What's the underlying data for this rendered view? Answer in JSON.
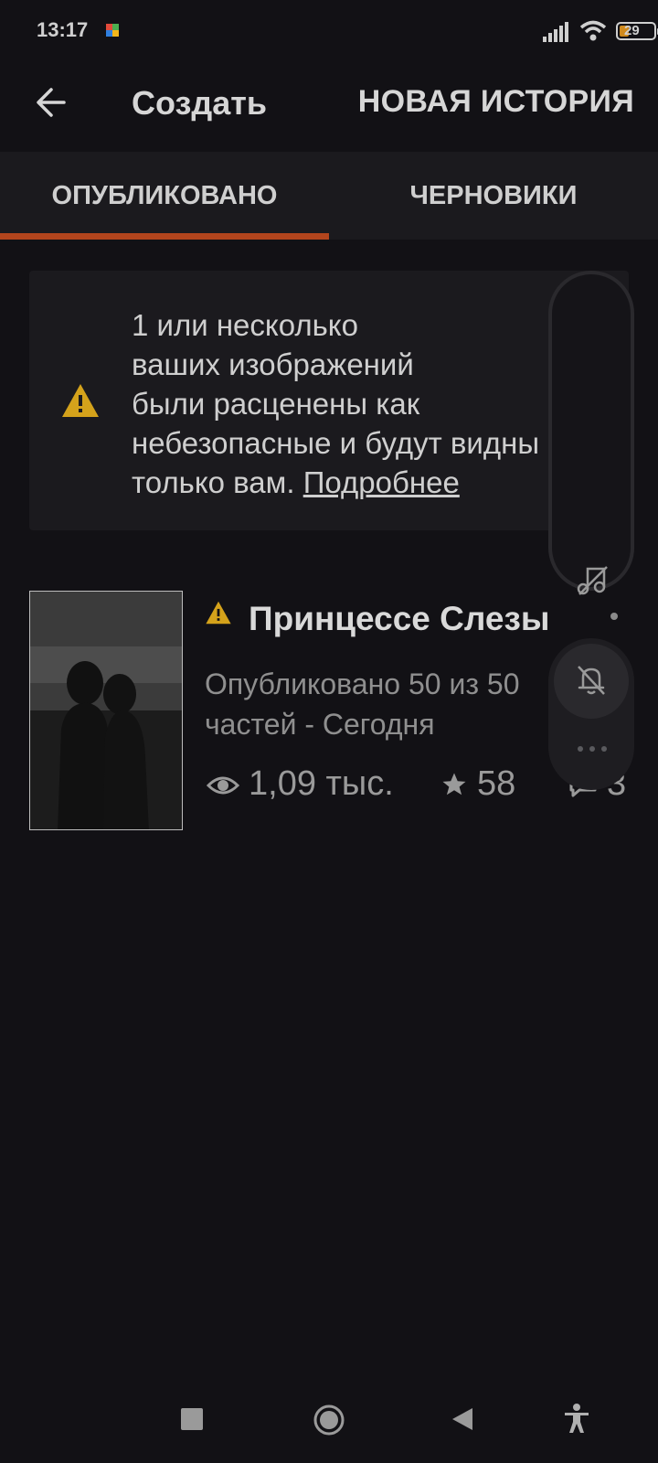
{
  "status_bar": {
    "time": "13:17",
    "battery": "29",
    "colors": {
      "battery_fill": "#d08a1d"
    }
  },
  "header": {
    "title": "Создать",
    "action": "НОВАЯ ИСТОРИЯ",
    "back_icon": "arrow-left-icon"
  },
  "tabs": [
    {
      "label": "ОПУБЛИКОВАНО",
      "active": true
    },
    {
      "label": "ЧЕРНОВИКИ",
      "active": false
    }
  ],
  "warning": {
    "text": "1 или несколько\nваших изображений\nбыли расценены как\nнебезопасные и будут видны\nтолько вам. ",
    "link": "Подробнее",
    "icon": "warning-triangle-icon",
    "color": "#d4a21b"
  },
  "story": {
    "title": "Принцессе Слезы",
    "meta": "Опубликовано 50 из 50\nчастей - Сегодня",
    "views": "1,09 тыс.",
    "stars": "58",
    "comments": "3"
  },
  "accent_color": "#b3451d"
}
